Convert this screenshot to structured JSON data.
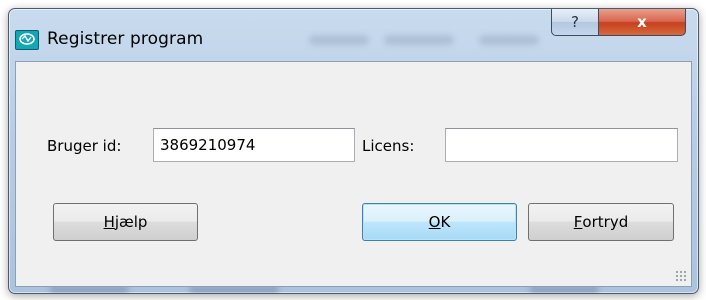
{
  "window": {
    "title": "Registrer program",
    "help_glyph": "?",
    "close_glyph": "x"
  },
  "form": {
    "user_id_label": "Bruger id:",
    "user_id_value": "3869210974",
    "license_label": "Licens:",
    "license_value": ""
  },
  "buttons": {
    "help": {
      "first": "H",
      "rest": "jælp"
    },
    "ok": {
      "first": "O",
      "rest": "K"
    },
    "cancel": {
      "first": "F",
      "rest": "ortryd"
    }
  },
  "colors": {
    "caption": "#b7cde6",
    "client": "#f0f0f0",
    "close": "#c6401f",
    "default_button_border": "#3c7fb1"
  }
}
